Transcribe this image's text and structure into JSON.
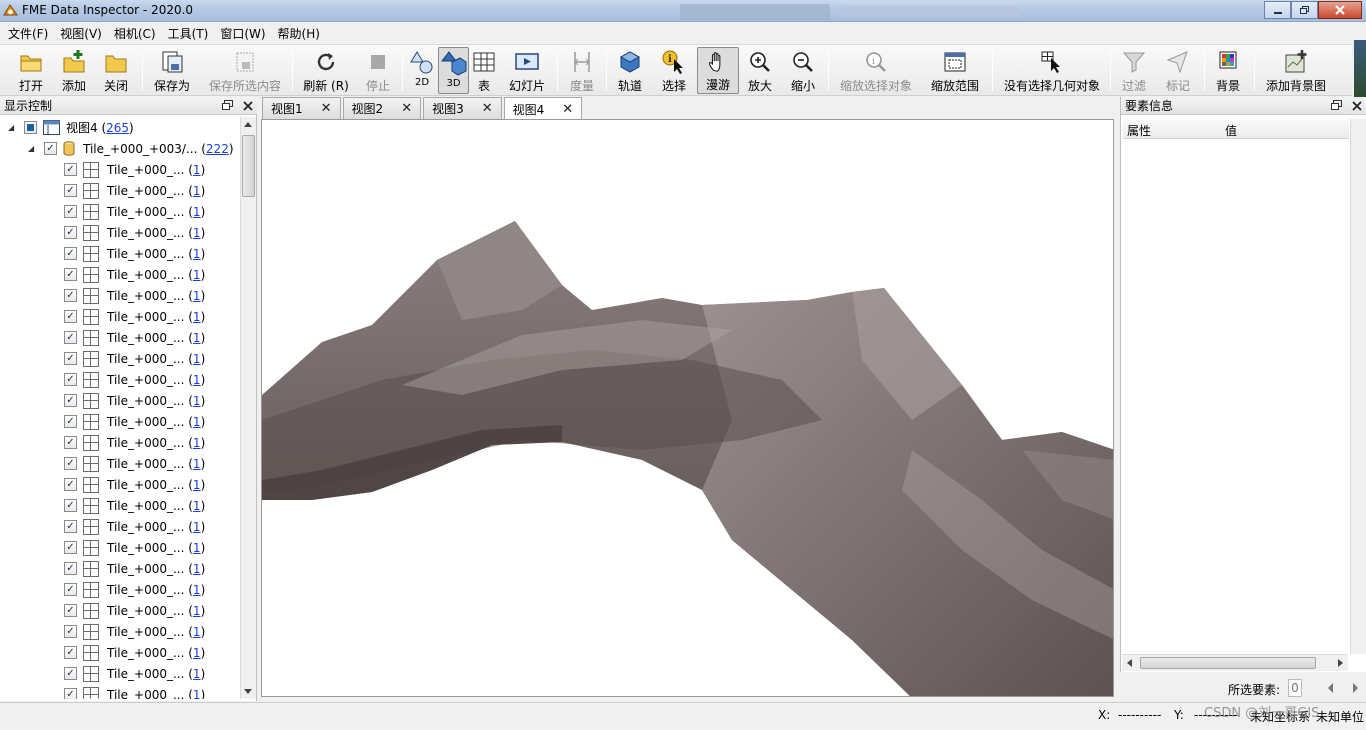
{
  "window": {
    "title": "FME Data Inspector - 2020.0"
  },
  "menu": [
    "文件(F)",
    "视图(V)",
    "相机(C)",
    "工具(T)",
    "窗口(W)",
    "帮助(H)"
  ],
  "toolbar": {
    "open": "打开",
    "add": "添加",
    "close": "关闭",
    "save_as": "保存为",
    "save_selected": "保存所选内容",
    "refresh": "刷新 (R)",
    "stop": "停止",
    "view2d": "2D",
    "view3d": "3D",
    "table": "表",
    "slideshow": "幻灯片",
    "measure": "度量",
    "orbit": "轨道",
    "select": "选择",
    "pan": "漫游",
    "zoom_in": "放大",
    "zoom_out": "缩小",
    "zoom_selected": "缩放选择对象",
    "zoom_extent": "缩放范围",
    "no_geometry_selected": "没有选择几何对象",
    "filter": "过滤",
    "mark": "标记",
    "background": "背景",
    "add_background": "添加背景图"
  },
  "display_control": {
    "title": "显示控制",
    "root": {
      "label": "视图4 (",
      "count": "265",
      "suffix": ")"
    },
    "dataset": {
      "label": "Tile_+000_+003/... (",
      "count": "222",
      "suffix": ")"
    },
    "tile_label": "Tile_+000_... (",
    "tile_count": "1",
    "tile_suffix": ")"
  },
  "tabs": [
    "视图1",
    "视图2",
    "视图3",
    "视图4"
  ],
  "feature_info": {
    "title": "要素信息",
    "col_attribute": "属性",
    "col_value": "值"
  },
  "selected": {
    "label": "所选要素:",
    "value": "0"
  },
  "status": {
    "x_label": "X:",
    "x_value": "----------",
    "y_label": "Y:",
    "y_value": "----------",
    "coord_sys": "未知坐标系",
    "unit": "未知单位"
  },
  "watermark": "CSDN @刘一哥GIS",
  "colors": {
    "title_bar": "#b4c8e3",
    "link": "#1a3fd6",
    "terrain": "#6f6464"
  }
}
